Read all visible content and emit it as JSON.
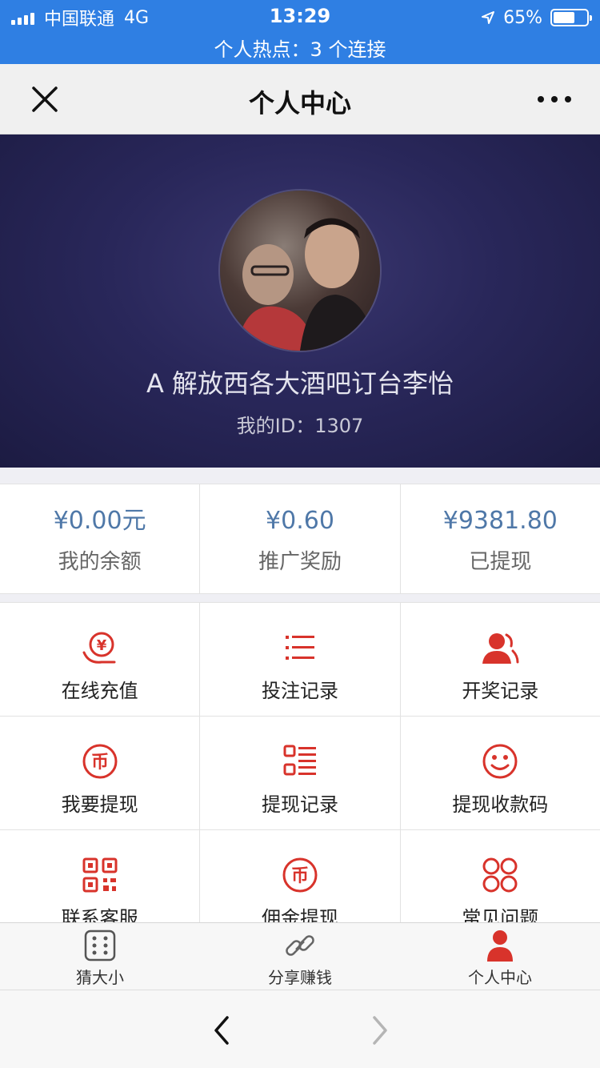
{
  "status_bar": {
    "carrier": "中国联通",
    "network": "4G",
    "time": "13:29",
    "battery": "65%",
    "battery_level": 0.65,
    "hotspot": "个人热点：3 个连接"
  },
  "nav": {
    "title": "个人中心",
    "close_icon": "close-icon",
    "more_icon": "more-icon"
  },
  "profile": {
    "name": "A 解放西各大酒吧订台李怡",
    "id_text": "我的ID：1307"
  },
  "stats": [
    {
      "value": "¥0.00元",
      "label": "我的余额"
    },
    {
      "value": "¥0.60",
      "label": "推广奖励"
    },
    {
      "value": "¥9381.80",
      "label": "已提现"
    }
  ],
  "menu": [
    {
      "label": "在线充值",
      "icon": "recharge-icon"
    },
    {
      "label": "投注记录",
      "icon": "list-icon"
    },
    {
      "label": "开奖记录",
      "icon": "users-icon"
    },
    {
      "label": "我要提现",
      "icon": "coin-icon"
    },
    {
      "label": "提现记录",
      "icon": "record-list-icon"
    },
    {
      "label": "提现收款码",
      "icon": "smile-icon"
    },
    {
      "label": "联系客服",
      "icon": "qr-code-icon"
    },
    {
      "label": "佣金提现",
      "icon": "coin-icon"
    },
    {
      "label": "常见问题",
      "icon": "circles-icon"
    }
  ],
  "tabs": [
    {
      "label": "猜大小",
      "icon": "dice-icon",
      "active": false
    },
    {
      "label": "分享赚钱",
      "icon": "link-icon",
      "active": false
    },
    {
      "label": "个人中心",
      "icon": "person-icon",
      "active": true
    }
  ],
  "colors": {
    "status_bar": "#2f7fe3",
    "accent_red": "#d8332b",
    "stat_value": "#4f78a8",
    "header_bg": "#29275a"
  }
}
